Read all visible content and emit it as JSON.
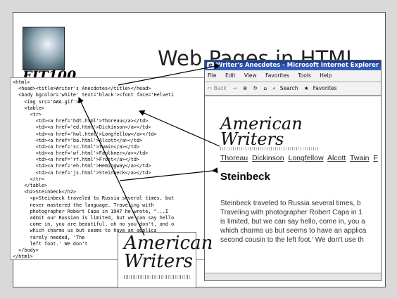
{
  "slide": {
    "title": "Web Pages in HTML",
    "logo_text": "FIT100"
  },
  "code": {
    "lines": [
      "<html>",
      "  <head><title>Writer's Anecdotes</title></head>",
      "  <body bgcolor='white' text='black'><font face='Helveti",
      "    <img src='AWA.gif'>",
      "    <table>",
      "      <tr>",
      "        <td><a href='hdt.html'>Thoreau</a></td>",
      "        <td><a href='ed.html'>Dickinson</a></td>",
      "        <td><a href='hwl.html'>Longfellow</a></td>",
      "        <td><a href='ba.html'>Alcott</a></td>",
      "        <td><a href='sc.html'>Twain</a></td>",
      "        <td><a href='wf.html'>Faulkner</a></td>",
      "        <td><a href='rf.html'>Frost</a></td>",
      "        <td><a href='eh.html'>Hemingway</a></td>",
      "        <td><a href='js.html'>Steinbeck</a></td>",
      "      </tr>",
      "    </table>",
      "    <h2>Steinbeck</h2>",
      "      <p>Steinbeck traveled to Russia several times, but",
      "      never mastered the language. Traveling with",
      "      photographer Robert Capa in 1947 he wrote, \"...I",
      "      admit our Russian is limited, but we can say hello",
      "      come in, you are beautiful, oh no you don't, and o",
      "      which charms us but seems to have an applica",
      "      rarely needed, 'The",
      "      left foot.' We don't",
      "  </body>",
      "</html>"
    ]
  },
  "browser": {
    "window_title": "Writer's Anecdotes - Microsoft Internet Explorer",
    "menu": [
      "File",
      "Edit",
      "View",
      "Favorites",
      "Tools",
      "Help"
    ],
    "toolbar": {
      "back": "⇦ Back",
      "forward": "→",
      "search": "Search",
      "favorites": "Favorites"
    },
    "banner_line1": "American",
    "banner_line2": "Writers",
    "links": [
      "Thoreau",
      "Dickinson",
      "Longfellow",
      "Alcott",
      "Twain",
      "F"
    ],
    "heading": "Steinbeck",
    "paragraph_lines": [
      "Steinbeck traveled to Russia several times, b",
      "Traveling with photographer Robert Capa in 1",
      "is limited, but we can say hello, come in, you a",
      "which charms us but seems to have an applica",
      "second cousin to the left foot.' We don't use th"
    ]
  },
  "image_callout": {
    "line1": "American",
    "line2": "Writers"
  },
  "colors": {
    "slide_background": "#ffffff",
    "page_background": "#d9d9d9",
    "browser_titlebar": "#1a3c8a"
  }
}
